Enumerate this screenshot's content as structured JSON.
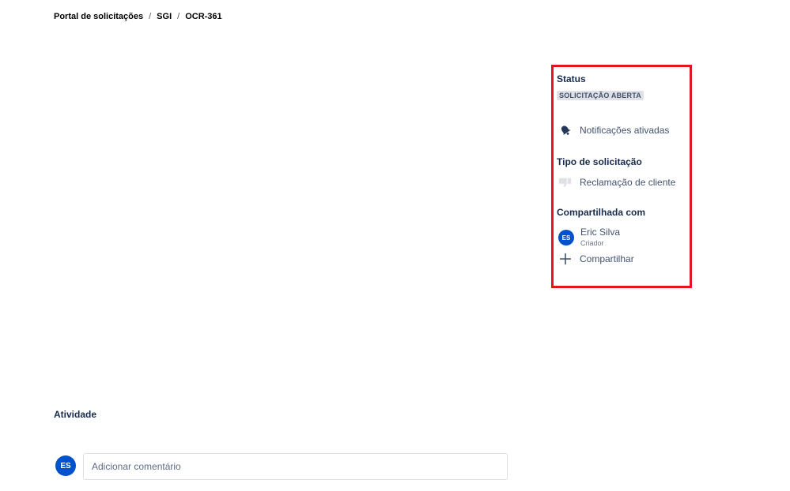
{
  "breadcrumb": {
    "items": [
      "Portal de solicitações",
      "SGI",
      "OCR-361"
    ],
    "separator": "/"
  },
  "sidebar": {
    "status_title": "Status",
    "status_value": "SOLICITAÇÃO ABERTA",
    "notifications_label": "Notificações ativadas",
    "request_type_title": "Tipo de solicitação",
    "request_type_value": "Reclamação de cliente",
    "shared_title": "Compartilhada com",
    "shared_user": {
      "initials": "ES",
      "name": "Eric Silva",
      "role": "Criador"
    },
    "share_label": "Compartilhar"
  },
  "activity": {
    "title": "Atividade",
    "avatar_initials": "ES",
    "comment_placeholder": "Adicionar comentário"
  },
  "colors": {
    "highlight_border": "#e3141d",
    "avatar_bg": "#0052cc",
    "lozenge_bg": "#dfe1e6"
  },
  "icons": [
    "bell-icon",
    "thumbs-down-icon",
    "plus-icon"
  ]
}
